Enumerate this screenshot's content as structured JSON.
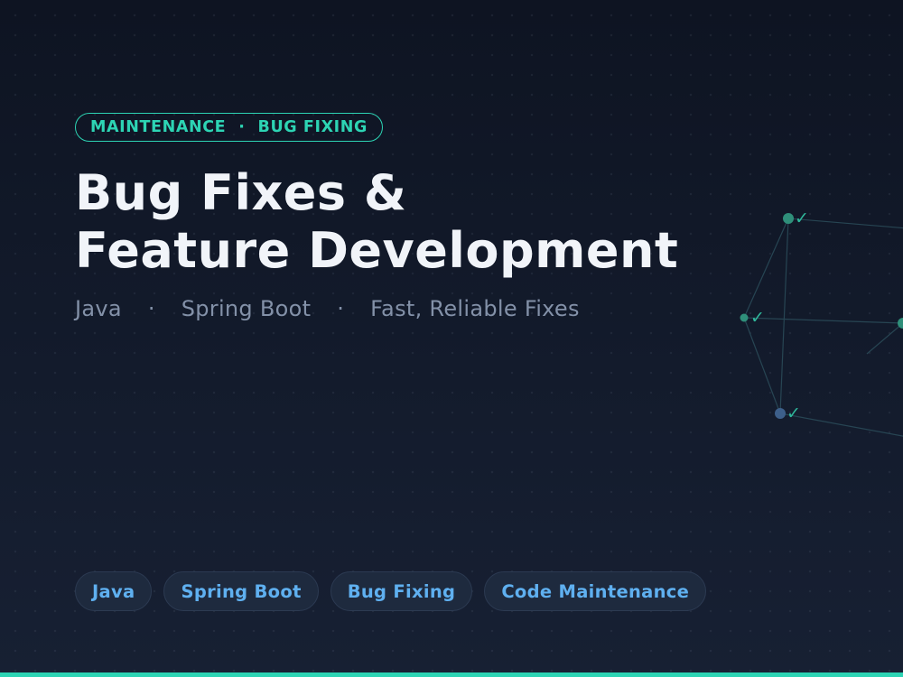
{
  "eyebrow": {
    "left": "MAINTENANCE",
    "separator": "·",
    "right": "BUG FIXING"
  },
  "headline": {
    "line1": "Bug Fixes &",
    "line2": "Feature Development"
  },
  "subline": {
    "item1": "Java",
    "item2": "Spring Boot",
    "item3": "Fast, Reliable Fixes",
    "separator": "·"
  },
  "tags": [
    "Java",
    "Spring Boot",
    "Bug Fixing",
    "Code Maintenance"
  ],
  "network": {
    "check_glyph": "✓"
  },
  "colors": {
    "accent_teal": "#2dd4b4",
    "tag_text": "#5fb0f0",
    "node_teal": "#2f8f7a",
    "node_blue": "#3d5f8a",
    "line": "#2a4a58"
  }
}
